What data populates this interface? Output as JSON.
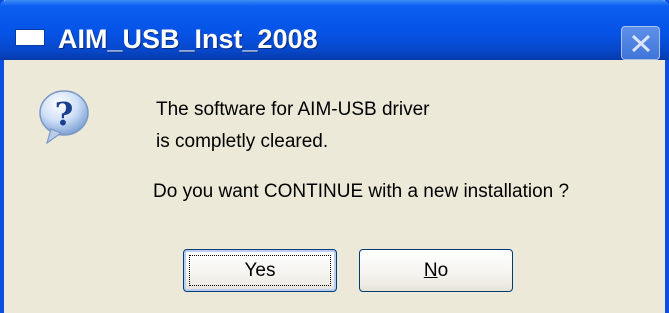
{
  "dialog": {
    "title": "AIM_USB_Inst_2008",
    "icon": "question-icon",
    "message_line1": "The software for AIM-USB driver",
    "message_line2": "is completly cleared.",
    "question": "Do you want CONTINUE with a new installation ?",
    "buttons": {
      "yes_label": "Yes",
      "no_label_first": "N",
      "no_label_rest": "o"
    }
  },
  "colors": {
    "titlebar": "#0653e6",
    "dialog_background": "#ece9d8",
    "button_border": "#003c74"
  }
}
